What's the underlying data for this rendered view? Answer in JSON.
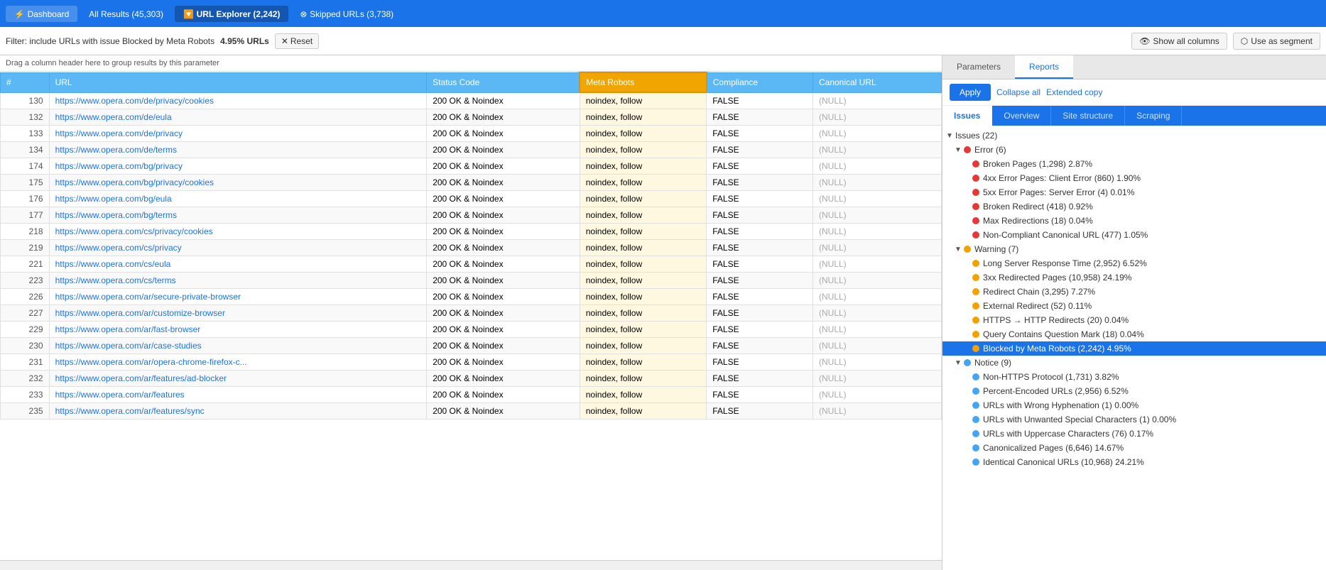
{
  "nav": {
    "dashboard": "Dashboard",
    "all_results": "All Results (45,303)",
    "url_explorer": "URL Explorer (2,242)",
    "skipped_urls": "Skipped URLs (3,738)"
  },
  "filter": {
    "label": "Filter: include URLs with issue Blocked by Meta Robots",
    "percent": "4.95% URLs",
    "reset": "Reset"
  },
  "toolbar": {
    "show_columns": "Show all columns",
    "use_segment": "Use as segment"
  },
  "drag_hint": "Drag a column header here to group results by this parameter",
  "table": {
    "columns": [
      "#",
      "URL",
      "Status Code",
      "Meta Robots",
      "Compliance",
      "Canonical URL"
    ],
    "rows": [
      {
        "num": "130",
        "url": "https://www.opera.com/de/privacy/cookies",
        "status": "200 OK & Noindex",
        "meta": "noindex, follow",
        "compliance": "FALSE",
        "canonical": "(NULL)"
      },
      {
        "num": "132",
        "url": "https://www.opera.com/de/eula",
        "status": "200 OK & Noindex",
        "meta": "noindex, follow",
        "compliance": "FALSE",
        "canonical": "(NULL)"
      },
      {
        "num": "133",
        "url": "https://www.opera.com/de/privacy",
        "status": "200 OK & Noindex",
        "meta": "noindex, follow",
        "compliance": "FALSE",
        "canonical": "(NULL)"
      },
      {
        "num": "134",
        "url": "https://www.opera.com/de/terms",
        "status": "200 OK & Noindex",
        "meta": "noindex, follow",
        "compliance": "FALSE",
        "canonical": "(NULL)"
      },
      {
        "num": "174",
        "url": "https://www.opera.com/bg/privacy",
        "status": "200 OK & Noindex",
        "meta": "noindex, follow",
        "compliance": "FALSE",
        "canonical": "(NULL)"
      },
      {
        "num": "175",
        "url": "https://www.opera.com/bg/privacy/cookies",
        "status": "200 OK & Noindex",
        "meta": "noindex, follow",
        "compliance": "FALSE",
        "canonical": "(NULL)"
      },
      {
        "num": "176",
        "url": "https://www.opera.com/bg/eula",
        "status": "200 OK & Noindex",
        "meta": "noindex, follow",
        "compliance": "FALSE",
        "canonical": "(NULL)"
      },
      {
        "num": "177",
        "url": "https://www.opera.com/bg/terms",
        "status": "200 OK & Noindex",
        "meta": "noindex, follow",
        "compliance": "FALSE",
        "canonical": "(NULL)"
      },
      {
        "num": "218",
        "url": "https://www.opera.com/cs/privacy/cookies",
        "status": "200 OK & Noindex",
        "meta": "noindex, follow",
        "compliance": "FALSE",
        "canonical": "(NULL)"
      },
      {
        "num": "219",
        "url": "https://www.opera.com/cs/privacy",
        "status": "200 OK & Noindex",
        "meta": "noindex, follow",
        "compliance": "FALSE",
        "canonical": "(NULL)"
      },
      {
        "num": "221",
        "url": "https://www.opera.com/cs/eula",
        "status": "200 OK & Noindex",
        "meta": "noindex, follow",
        "compliance": "FALSE",
        "canonical": "(NULL)"
      },
      {
        "num": "223",
        "url": "https://www.opera.com/cs/terms",
        "status": "200 OK & Noindex",
        "meta": "noindex, follow",
        "compliance": "FALSE",
        "canonical": "(NULL)"
      },
      {
        "num": "226",
        "url": "https://www.opera.com/ar/secure-private-browser",
        "status": "200 OK & Noindex",
        "meta": "noindex, follow",
        "compliance": "FALSE",
        "canonical": "(NULL)"
      },
      {
        "num": "227",
        "url": "https://www.opera.com/ar/customize-browser",
        "status": "200 OK & Noindex",
        "meta": "noindex, follow",
        "compliance": "FALSE",
        "canonical": "(NULL)"
      },
      {
        "num": "229",
        "url": "https://www.opera.com/ar/fast-browser",
        "status": "200 OK & Noindex",
        "meta": "noindex, follow",
        "compliance": "FALSE",
        "canonical": "(NULL)"
      },
      {
        "num": "230",
        "url": "https://www.opera.com/ar/case-studies",
        "status": "200 OK & Noindex",
        "meta": "noindex, follow",
        "compliance": "FALSE",
        "canonical": "(NULL)"
      },
      {
        "num": "231",
        "url": "https://www.opera.com/ar/opera-chrome-firefox-c...",
        "status": "200 OK & Noindex",
        "meta": "noindex, follow",
        "compliance": "FALSE",
        "canonical": "(NULL)"
      },
      {
        "num": "232",
        "url": "https://www.opera.com/ar/features/ad-blocker",
        "status": "200 OK & Noindex",
        "meta": "noindex, follow",
        "compliance": "FALSE",
        "canonical": "(NULL)"
      },
      {
        "num": "233",
        "url": "https://www.opera.com/ar/features",
        "status": "200 OK & Noindex",
        "meta": "noindex, follow",
        "compliance": "FALSE",
        "canonical": "(NULL)"
      },
      {
        "num": "235",
        "url": "https://www.opera.com/ar/features/sync",
        "status": "200 OK & Noindex",
        "meta": "noindex, follow",
        "compliance": "FALSE",
        "canonical": "(NULL)"
      }
    ]
  },
  "right": {
    "tabs": {
      "parameters": "Parameters",
      "reports": "Reports"
    },
    "toolbar": {
      "apply": "Apply",
      "collapse_all": "Collapse all",
      "extended_copy": "Extended copy"
    },
    "issues_tabs": [
      "Issues",
      "Overview",
      "Site structure",
      "Scraping"
    ],
    "tree": {
      "issues_label": "Issues (22)",
      "error_label": "Error (6)",
      "error_items": [
        "Broken Pages (1,298) 2.87%",
        "4xx Error Pages: Client Error (860) 1.90%",
        "5xx Error Pages: Server Error (4) 0.01%",
        "Broken Redirect (418) 0.92%",
        "Max Redirections (18) 0.04%",
        "Non-Compliant Canonical URL (477) 1.05%"
      ],
      "warning_label": "Warning (7)",
      "warning_items": [
        "Long Server Response Time (2,952) 6.52%",
        "3xx Redirected Pages (10,958) 24.19%",
        "Redirect Chain (3,295) 7.27%",
        "External Redirect (52) 0.11%",
        "HTTPS → HTTP Redirects (20) 0.04%",
        "Query Contains Question Mark (18) 0.04%",
        "Blocked by Meta Robots (2,242) 4.95%"
      ],
      "notice_label": "Notice (9)",
      "notice_items": [
        "Non-HTTPS Protocol (1,731) 3.82%",
        "Percent-Encoded URLs (2,956) 6.52%",
        "URLs with Wrong Hyphenation (1) 0.00%",
        "URLs with Unwanted Special Characters (1) 0.00%",
        "URLs with Uppercase Characters (76) 0.17%",
        "Canonicalized Pages (6,646) 14.67%",
        "Identical Canonical URLs (10,968) 24.21%"
      ]
    }
  },
  "colors": {
    "blue_header": "#5bb8f5",
    "nav_blue": "#1a73e8",
    "highlight_col": "#f0a500",
    "selected_row": "#1a73e8"
  }
}
